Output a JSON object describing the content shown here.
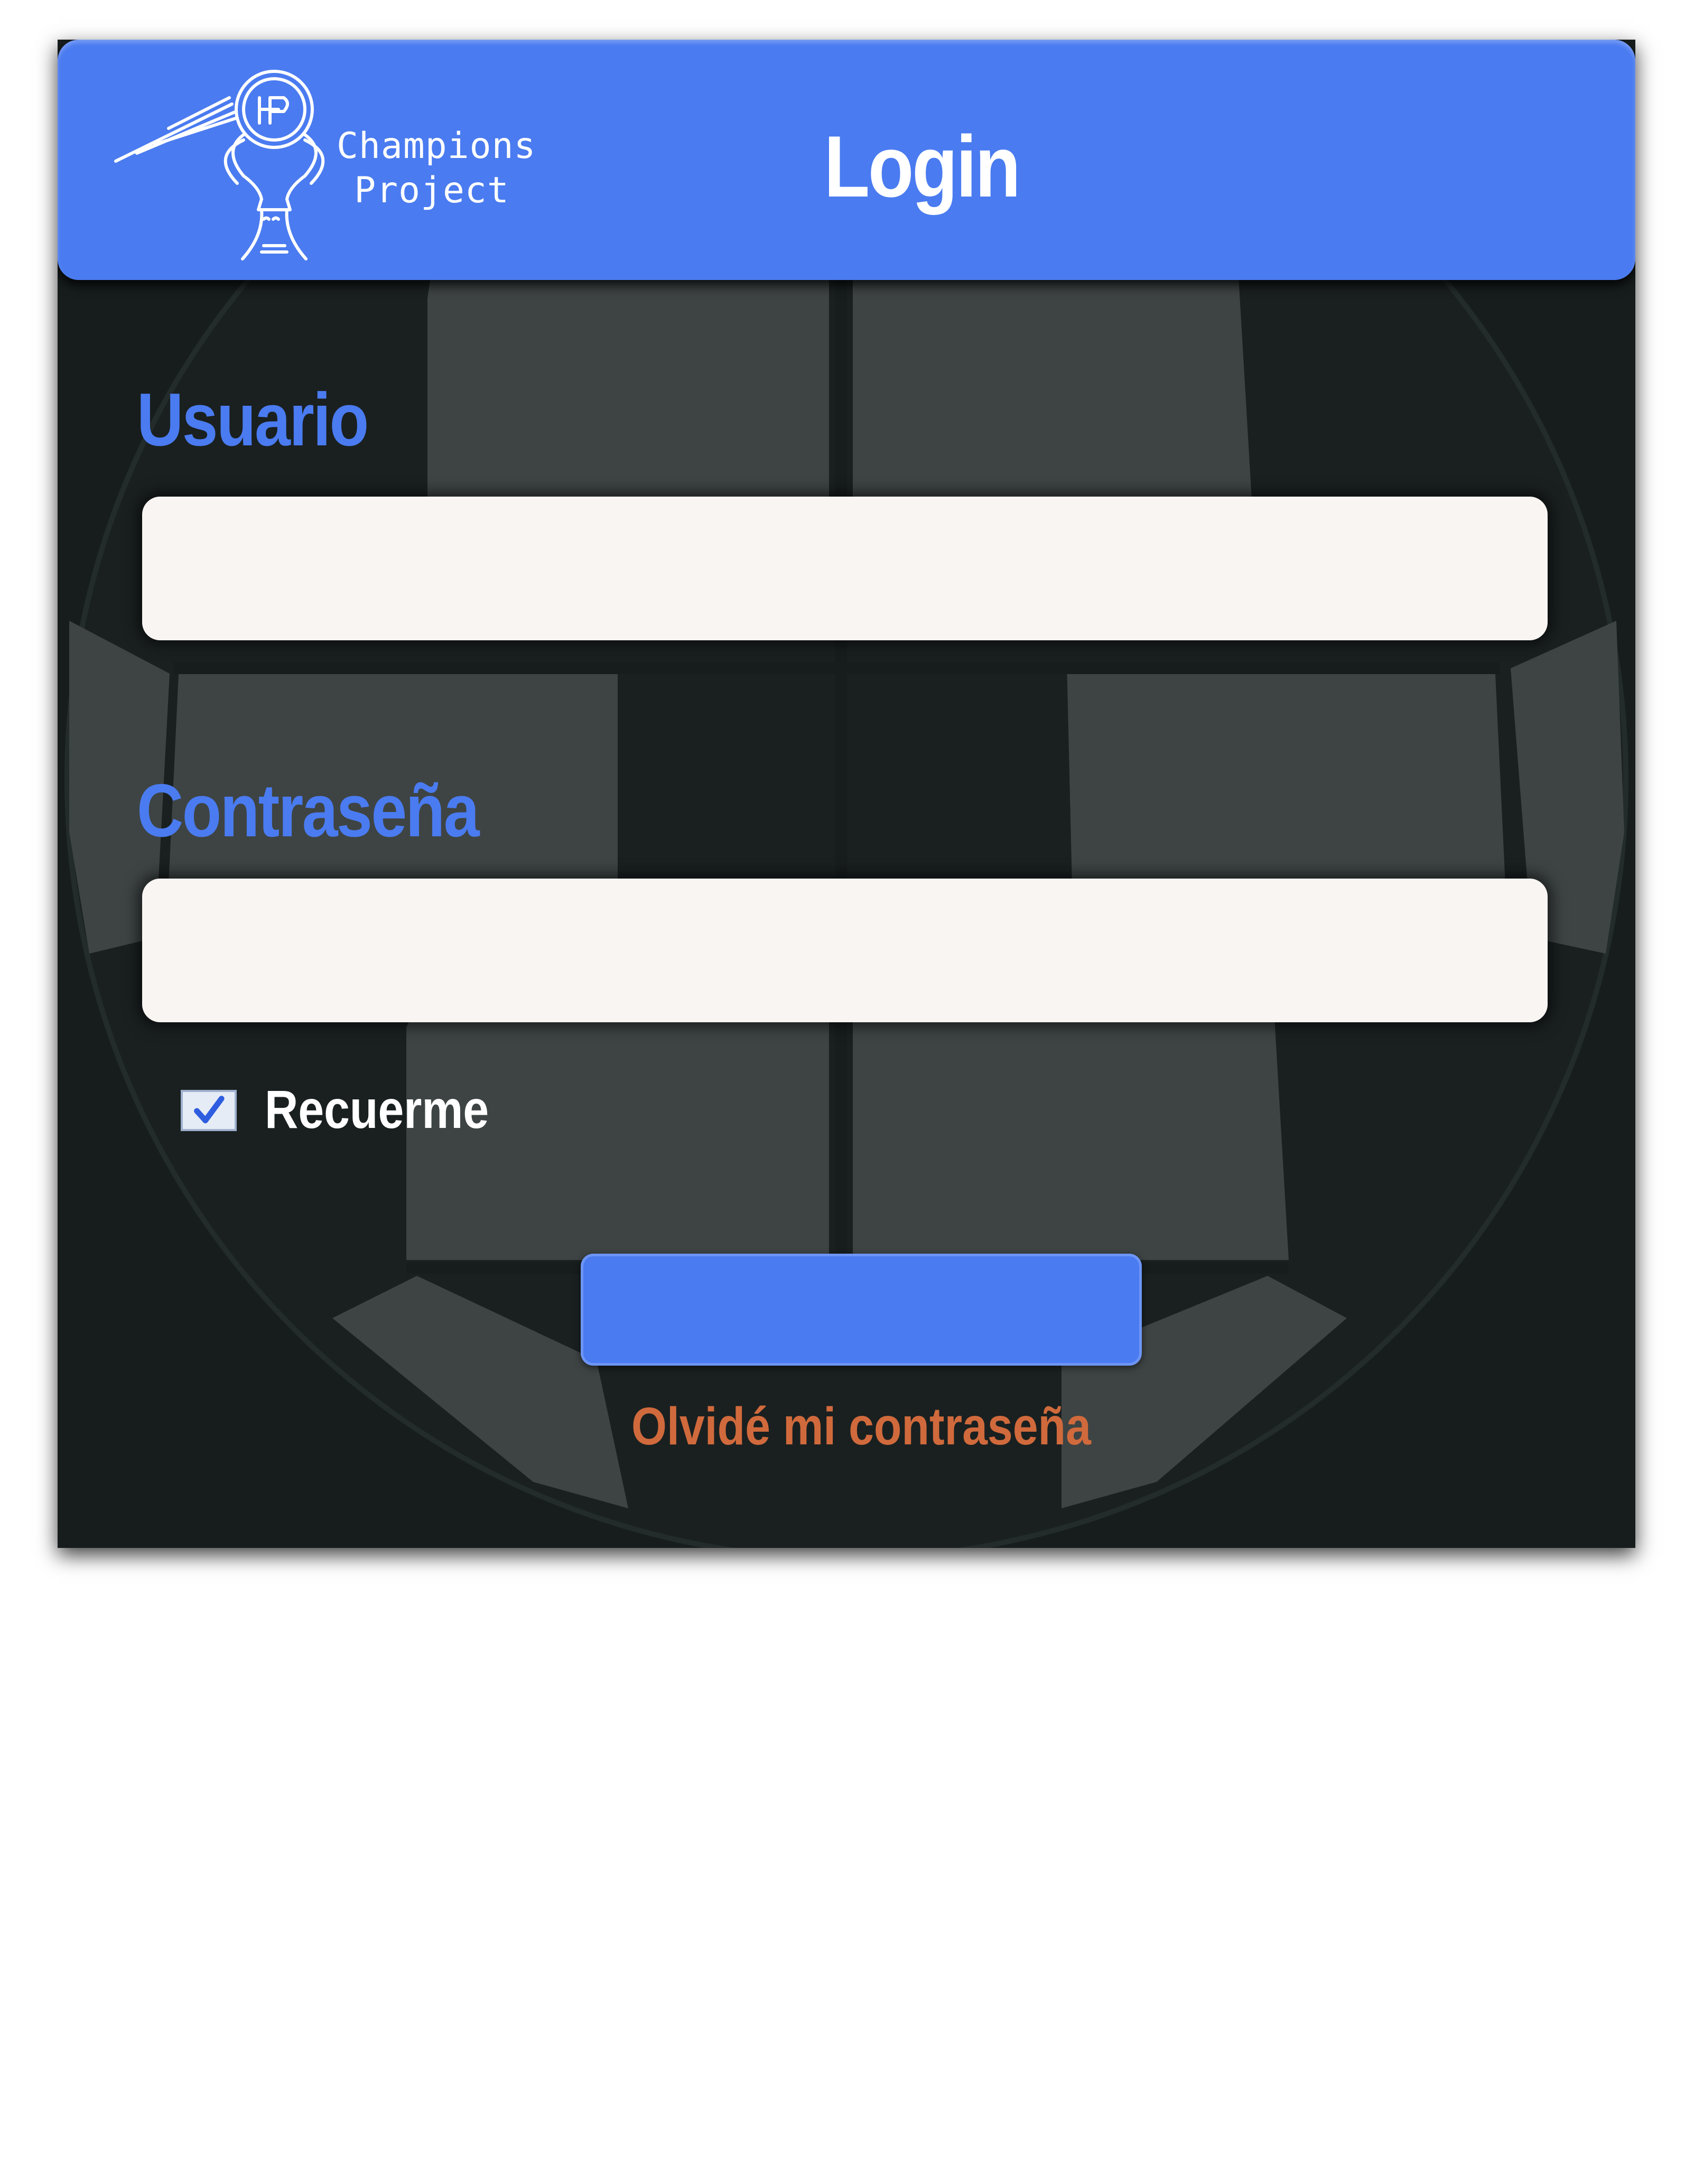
{
  "header": {
    "brand_line1": "Champions",
    "brand_line2": "Project",
    "title": "Login"
  },
  "form": {
    "username_label": "Usuario",
    "username_value": "",
    "password_label": "Contraseña",
    "password_value": "",
    "remember_label": "Recuerme",
    "remember_checked": true,
    "submit_label": "",
    "forgot_link": "Olvidé mi contraseña"
  },
  "colors": {
    "accent": "#4a7bf0",
    "background": "#171d1d",
    "link": "#d06a3c",
    "input": "#f9f5f3"
  },
  "icons": {
    "logo": "trophy-ball-logo-icon",
    "checkbox": "checkmark-icon"
  }
}
